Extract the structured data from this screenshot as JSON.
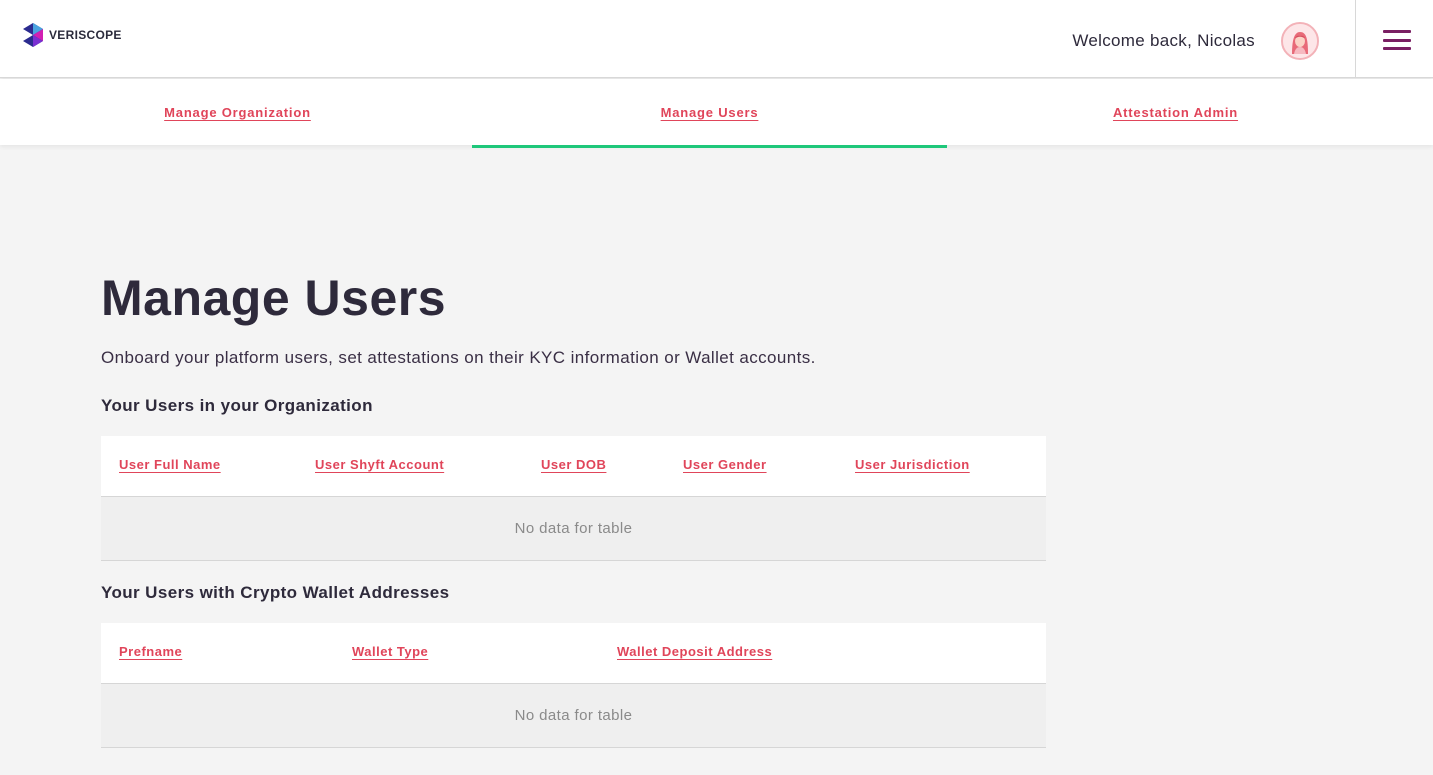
{
  "header": {
    "logo_text": "VERISCOPE",
    "welcome": "Welcome back, Nicolas",
    "accent_color": "#7a1f63"
  },
  "tabs": [
    {
      "label": "Manage Organization",
      "active": false
    },
    {
      "label": "Manage Users",
      "active": true
    },
    {
      "label": "Attestation Admin",
      "active": false
    }
  ],
  "tab_indicator_color": "#1ec77a",
  "link_color": "#e0455a",
  "main": {
    "title": "Manage Users",
    "subtitle": "Onboard your platform users, set attestations on their KYC information or Wallet accounts.",
    "users_section": {
      "title": "Your Users in your Organization",
      "columns": [
        "User Full Name",
        "User Shyft Account",
        "User DOB",
        "User Gender",
        "User Jurisdiction"
      ],
      "empty_text": "No data for table"
    },
    "wallets_section": {
      "title": "Your Users with Crypto Wallet Addresses",
      "columns": [
        "Prefname",
        "Wallet Type",
        "Wallet Deposit Address"
      ],
      "empty_text": "No data for table"
    }
  }
}
